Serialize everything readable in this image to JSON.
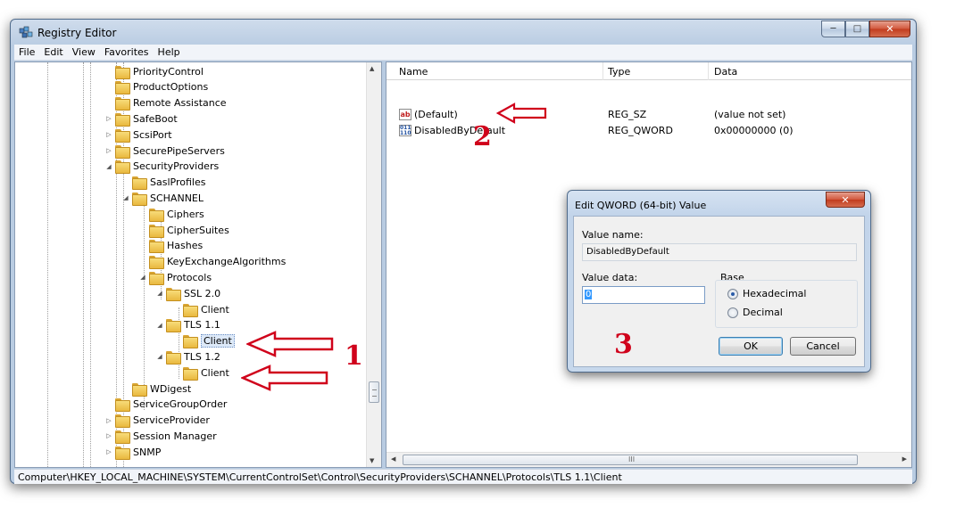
{
  "window": {
    "title": "Registry Editor",
    "minimize_glyph": "─",
    "maximize_glyph": "□",
    "close_glyph": "✕"
  },
  "menu": [
    "File",
    "Edit",
    "View",
    "Favorites",
    "Help"
  ],
  "tree": {
    "items": [
      {
        "label": "PriorityControl",
        "expander": ""
      },
      {
        "label": "ProductOptions",
        "expander": ""
      },
      {
        "label": "Remote Assistance",
        "expander": ""
      },
      {
        "label": "SafeBoot",
        "expander": "▷"
      },
      {
        "label": "ScsiPort",
        "expander": "▷"
      },
      {
        "label": "SecurePipeServers",
        "expander": "▷"
      },
      {
        "label": "SecurityProviders",
        "expander": "◢"
      },
      {
        "label": "SaslProfiles",
        "expander": ""
      },
      {
        "label": "SCHANNEL",
        "expander": "◢"
      },
      {
        "label": "Ciphers",
        "expander": ""
      },
      {
        "label": "CipherSuites",
        "expander": ""
      },
      {
        "label": "Hashes",
        "expander": ""
      },
      {
        "label": "KeyExchangeAlgorithms",
        "expander": ""
      },
      {
        "label": "Protocols",
        "expander": "◢"
      },
      {
        "label": "SSL 2.0",
        "expander": "◢"
      },
      {
        "label": "Client",
        "expander": ""
      },
      {
        "label": "TLS 1.1",
        "expander": "◢"
      },
      {
        "label": "Client",
        "expander": ""
      },
      {
        "label": "TLS 1.2",
        "expander": "◢"
      },
      {
        "label": "Client",
        "expander": ""
      },
      {
        "label": "WDigest",
        "expander": ""
      },
      {
        "label": "ServiceGroupOrder",
        "expander": ""
      },
      {
        "label": "ServiceProvider",
        "expander": "▷"
      },
      {
        "label": "Session Manager",
        "expander": "▷"
      },
      {
        "label": "SNMP",
        "expander": "▷"
      }
    ],
    "selected": "Client"
  },
  "list": {
    "columns": [
      "Name",
      "Type",
      "Data"
    ],
    "rows": [
      {
        "name": "(Default)",
        "type": "REG_SZ",
        "data": "(value not set)",
        "icon": "string-value-icon",
        "icon_text": "ab"
      },
      {
        "name": "DisabledByDefault",
        "type": "REG_QWORD",
        "data": "0x00000000 (0)",
        "icon": "binary-value-icon",
        "icon_text": "011 110"
      }
    ],
    "scroll_grip": "III"
  },
  "status": "Computer\\HKEY_LOCAL_MACHINE\\SYSTEM\\CurrentControlSet\\Control\\SecurityProviders\\SCHANNEL\\Protocols\\TLS 1.1\\Client",
  "dialog": {
    "title": "Edit QWORD (64-bit) Value",
    "close_glyph": "✕",
    "value_name_label": "Value name:",
    "value_name": "DisabledByDefault",
    "value_data_label": "Value data:",
    "value_data": "0",
    "base_label": "Base",
    "base_options": [
      "Hexadecimal",
      "Decimal"
    ],
    "base_selected": "Hexadecimal",
    "ok": "OK",
    "cancel": "Cancel"
  },
  "annotations": {
    "one": "1",
    "two": "2",
    "three": "3",
    "color": "#d0021b"
  },
  "scroll_glyphs": {
    "up": "▲",
    "down": "▼",
    "left": "◀",
    "right": "▶"
  }
}
